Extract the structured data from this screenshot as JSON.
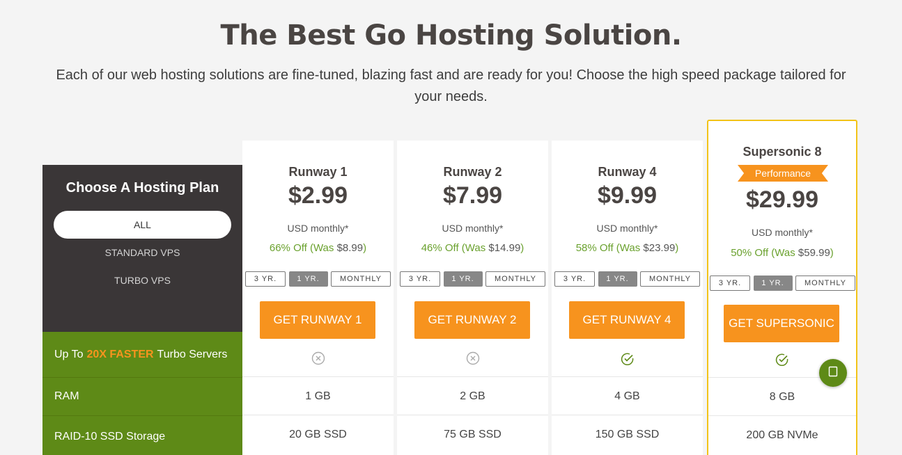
{
  "header": {
    "title": "The Best Go Hosting Solution.",
    "subtitle": "Each of our web hosting solutions are fine-tuned, blazing fast and are ready for you! Choose the high speed package tailored for your needs."
  },
  "sidebar": {
    "heading": "Choose A Hosting Plan",
    "filters": [
      "ALL",
      "STANDARD VPS",
      "TURBO VPS"
    ],
    "features": {
      "turbo_prefix": "Up To ",
      "turbo_highlight": "20X FASTER",
      "turbo_suffix": " Turbo Servers",
      "ram": "RAM",
      "storage": "RAID-10 SSD Storage"
    }
  },
  "terms": [
    "3 YR.",
    "1 YR.",
    "MONTHLY"
  ],
  "selected_term": "1 YR.",
  "plans": [
    {
      "name": "Runway 1",
      "price": "$2.99",
      "period": "USD monthly*",
      "discount": "66% Off (Was ",
      "was": "$8.99",
      "close": ")",
      "cta": "GET RUNWAY 1",
      "turbo": false,
      "ram": "1 GB",
      "storage": "20 GB SSD"
    },
    {
      "name": "Runway 2",
      "price": "$7.99",
      "period": "USD monthly*",
      "discount": "46% Off (Was ",
      "was": "$14.99",
      "close": ")",
      "cta": "GET RUNWAY 2",
      "turbo": false,
      "ram": "2 GB",
      "storage": "75 GB SSD"
    },
    {
      "name": "Runway 4",
      "price": "$9.99",
      "period": "USD monthly*",
      "discount": "58% Off (Was ",
      "was": "$23.99",
      "close": ")",
      "cta": "GET RUNWAY 4",
      "turbo": true,
      "ram": "4 GB",
      "storage": "150 GB SSD"
    },
    {
      "name": "Supersonic 8",
      "badge": "Performance",
      "price": "$29.99",
      "period": "USD monthly*",
      "discount": "50% Off (Was ",
      "was": "$59.99",
      "close": ")",
      "cta": "GET SUPERSONIC",
      "turbo": true,
      "ram": "8 GB",
      "storage": "200 GB NVMe"
    }
  ],
  "colors": {
    "accent_orange": "#f7931e",
    "feature_green": "#5e8a17",
    "discount_green": "#6aa12e",
    "featured_border": "#f2c318",
    "dark_panel": "#3a3637"
  },
  "icons": {
    "excluded": "x-circle-icon",
    "included": "check-circle-icon",
    "chat": "chat-icon"
  }
}
